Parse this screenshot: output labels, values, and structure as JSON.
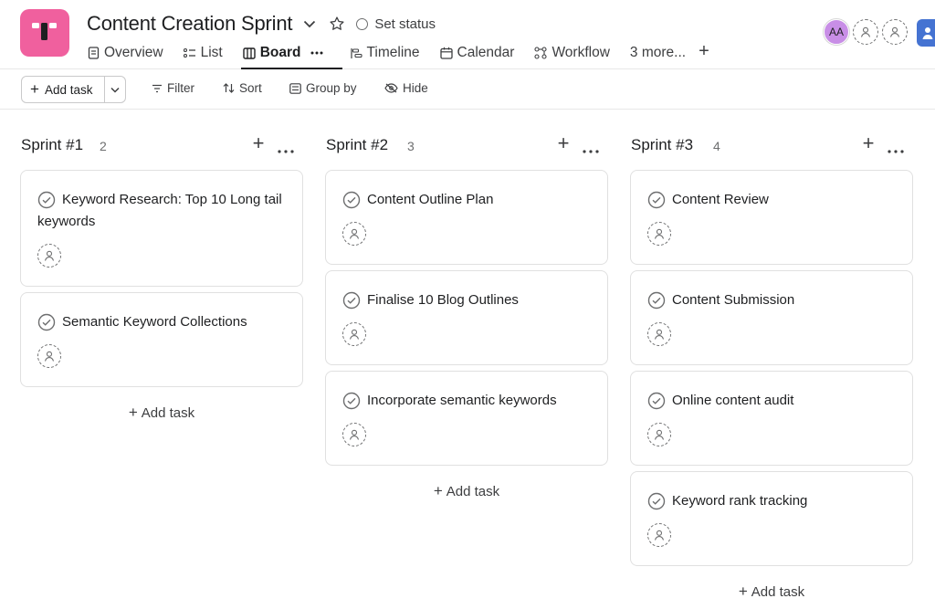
{
  "project": {
    "title": "Content Creation Sprint",
    "set_status": "Set status",
    "brand_color": "#f0609e"
  },
  "tabs": [
    {
      "label": "Overview",
      "icon": "document-icon"
    },
    {
      "label": "List",
      "icon": "list-icon"
    },
    {
      "label": "Board",
      "icon": "board-icon",
      "active": true
    },
    {
      "label": "Timeline",
      "icon": "timeline-icon"
    },
    {
      "label": "Calendar",
      "icon": "calendar-icon"
    },
    {
      "label": "Workflow",
      "icon": "workflow-icon"
    },
    {
      "label": "3 more..."
    }
  ],
  "members": {
    "initials": "AA",
    "avatar_color": "#c88ee6"
  },
  "toolbar": {
    "add_task": "Add task",
    "filter": "Filter",
    "sort": "Sort",
    "group_by": "Group by",
    "hide": "Hide"
  },
  "columns": [
    {
      "title": "Sprint #1",
      "count": "2",
      "add_task": "Add task",
      "cards": [
        {
          "title": "Keyword Research: Top 10 Long tail keywords"
        },
        {
          "title": "Semantic Keyword Collections"
        }
      ]
    },
    {
      "title": "Sprint #2",
      "count": "3",
      "add_task": "Add task",
      "cards": [
        {
          "title": "Content Outline Plan"
        },
        {
          "title": "Finalise 10 Blog Outlines"
        },
        {
          "title": "Incorporate semantic keywords"
        }
      ]
    },
    {
      "title": "Sprint #3",
      "count": "4",
      "add_task": "Add task",
      "cards": [
        {
          "title": "Content Review"
        },
        {
          "title": "Content Submission"
        },
        {
          "title": "Online content audit"
        },
        {
          "title": "Keyword rank tracking"
        }
      ]
    }
  ]
}
